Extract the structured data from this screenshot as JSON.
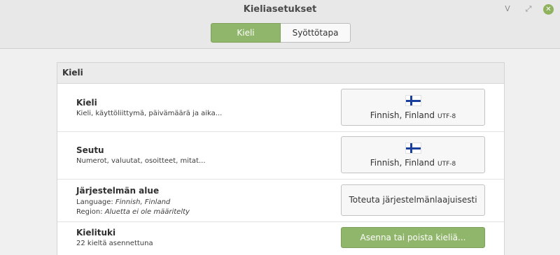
{
  "window": {
    "title": "Kieliasetukset",
    "minimize_glyph": "ᐯ",
    "maximize_glyph": "⤢",
    "close_glyph": "✕"
  },
  "tabs": [
    {
      "label": "Kieli",
      "active": true
    },
    {
      "label": "Syöttötapa",
      "active": false
    }
  ],
  "panel": {
    "heading": "Kieli",
    "rows": [
      {
        "title": "Kieli",
        "subtitle": "Kieli, käyttöliittymä, päivämäärä ja aika...",
        "button_label": "Finnish, Finland",
        "button_encoding": "UTF-8",
        "button_icon": "finland-flag-icon"
      },
      {
        "title": "Seutu",
        "subtitle": "Numerot, valuutat, osoitteet, mitat...",
        "button_label": "Finnish, Finland",
        "button_encoding": "UTF-8",
        "button_icon": "finland-flag-icon"
      },
      {
        "title": "Järjestelmän alue",
        "language_prefix": "Language: ",
        "language_value": "Finnish, Finland",
        "region_prefix": "Region: ",
        "region_value": "Aluetta ei ole määritelty",
        "button_label": "Toteuta järjestelmänlaajuisesti"
      },
      {
        "title": "Kielituki",
        "subtitle": "22 kieltä asennettuna",
        "button_label": "Asenna tai poista kieliä..."
      }
    ]
  },
  "colors": {
    "accent_green": "#8fb66a",
    "close_button": "#8fb25f",
    "flag_blue": "#1a3f9c"
  }
}
